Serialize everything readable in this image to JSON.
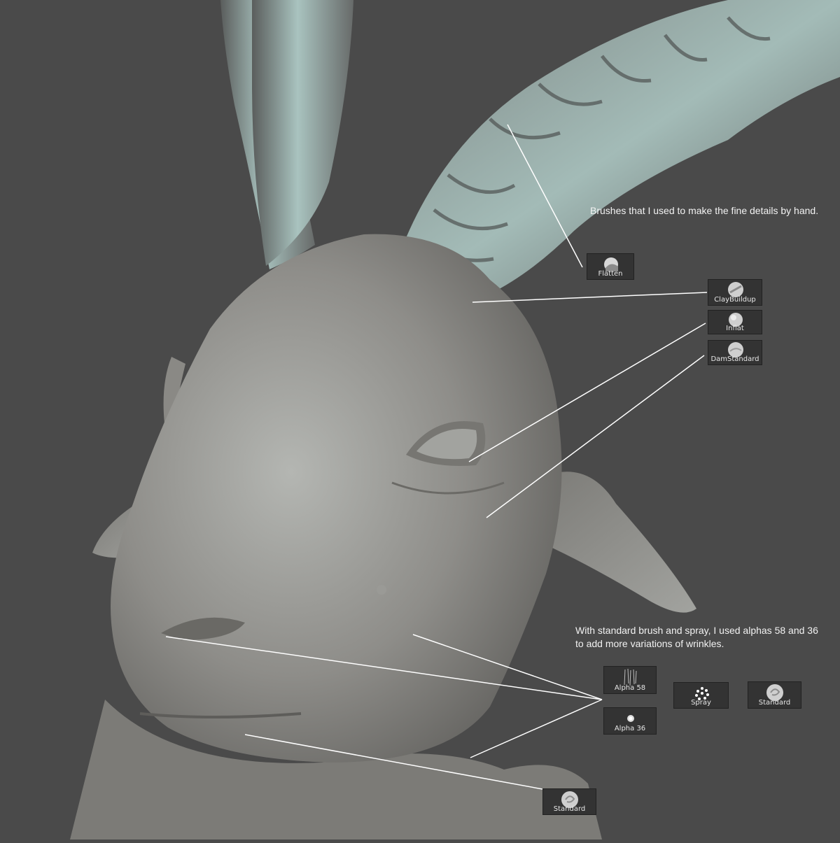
{
  "annotations": {
    "brushes_note": "Brushes that I used to make the fine details by hand.",
    "wrinkles_note_line1": "With standard brush and spray, I used alphas 58 and 36",
    "wrinkles_note_line2": "to add more variations of wrinkles."
  },
  "brushes": [
    {
      "label": "Flatten",
      "icon": "flatten-brush-icon"
    },
    {
      "label": "ClayBuildup",
      "icon": "claybuildup-brush-icon"
    },
    {
      "label": "Inflat",
      "icon": "inflat-brush-icon"
    },
    {
      "label": "DamStandard",
      "icon": "damstandard-brush-icon"
    }
  ],
  "wrinkle_tools": [
    {
      "label": "Alpha 58",
      "icon": "alpha-58-icon"
    },
    {
      "label": "Alpha 36",
      "icon": "alpha-36-icon"
    },
    {
      "label": "Spray",
      "icon": "spray-stroke-icon"
    },
    {
      "label": "Standard",
      "icon": "standard-brush-icon"
    }
  ],
  "mouth_tool": {
    "label": "Standard",
    "icon": "standard-brush-icon"
  },
  "colors": {
    "background": "#4a4a4a",
    "clay": "#8e8d89",
    "horn_highlight": "#a9c3bf",
    "tile_bg": "#333333",
    "leader_line": "#ffffff"
  }
}
